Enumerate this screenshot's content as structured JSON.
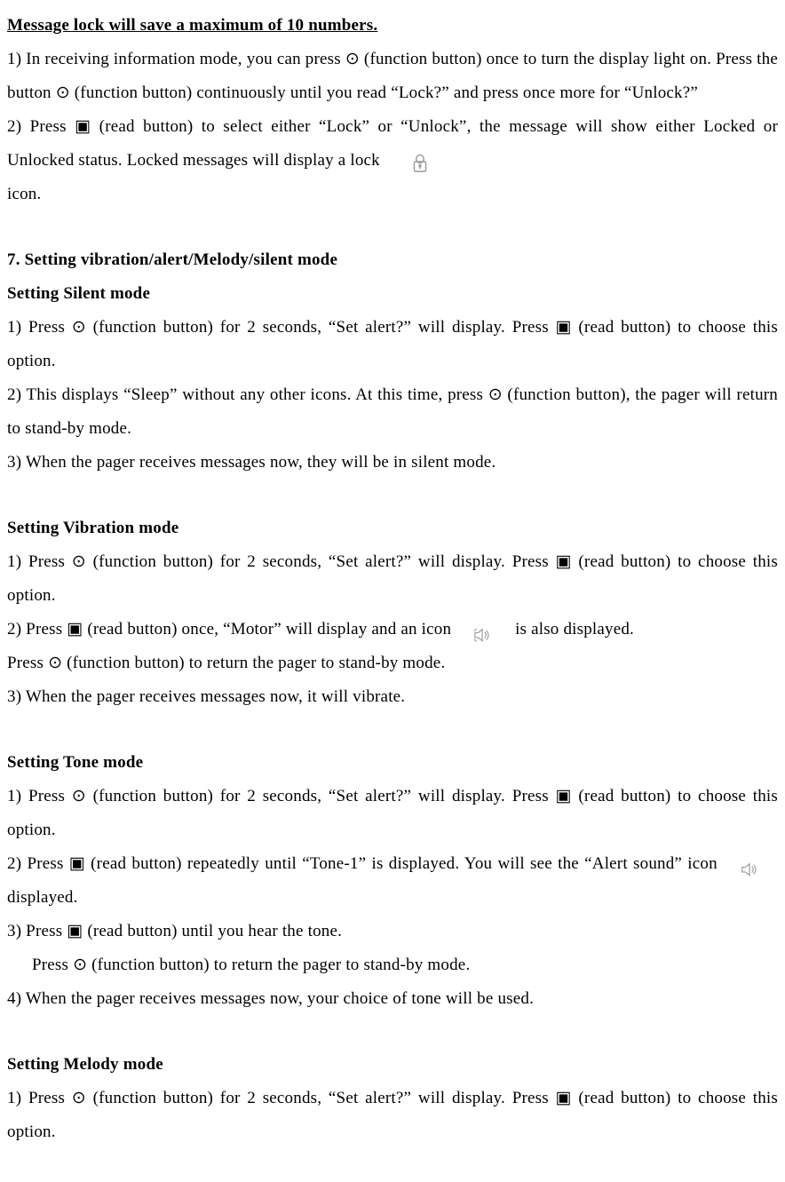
{
  "title": "Message lock will save a maximum of 10 numbers.",
  "lock": {
    "step1": "1) In receiving information mode, you can press ⊙ (function button) once to turn the display light on.  Press the button ⊙ (function button) continuously until you read “Lock?” and press once more for “Unlock?”",
    "step2a": "2) Press ▣ (read button) to select either “Lock” or “Unlock”, the message will show either Locked or Unlocked status.   Locked messages will display a lock",
    "step2b": " icon."
  },
  "section7_title": "7. Setting vibration/alert/Melody/silent mode",
  "silent": {
    "heading": "Setting Silent mode",
    "step1": "1) Press ⊙ (function button) for 2 seconds, “Set alert?” will display.  Press ▣ (read button) to choose this option.",
    "step2": "2) This displays “Sleep” without any other icons. At this time, press ⊙ (function button),  the pager will return to stand-by mode.",
    "step3": "3) When the pager receives messages now, they will be in silent mode."
  },
  "vibration": {
    "heading": "Setting Vibration mode",
    "step1": "1) Press ⊙ (function button) for 2 seconds, “Set alert?” will display.  Press ▣ (read button) to choose this option.",
    "step2a": "2) Press ▣ (read button) once, “Motor” will display and an icon ",
    "step2b": " is also displayed.",
    "step2c": "Press ⊙ (function button) to return the pager to stand-by mode.",
    "step3": "3) When the pager receives messages now, it will vibrate."
  },
  "tone": {
    "heading": "Setting Tone mode",
    "step1": "1) Press ⊙ (function button) for 2 seconds, “Set alert?” will display. Press ▣ (read button) to choose this option.",
    "step2a": "2) Press ▣ (read button) repeatedly until “Tone-1” is displayed. You will see the “Alert sound” icon ",
    "step2b": " displayed.",
    "step3a": "3) Press ▣ (read button) until you hear the tone.",
    "step3b": "Press ⊙ (function button) to return the pager to stand-by mode.",
    "step4": "4) When the pager receives messages now, your choice of tone will be used."
  },
  "melody": {
    "heading": "Setting Melody mode",
    "step1": "1) Press ⊙ (function button) for 2 seconds, “Set alert?” will display.  Press ▣ (read button) to choose this option."
  }
}
